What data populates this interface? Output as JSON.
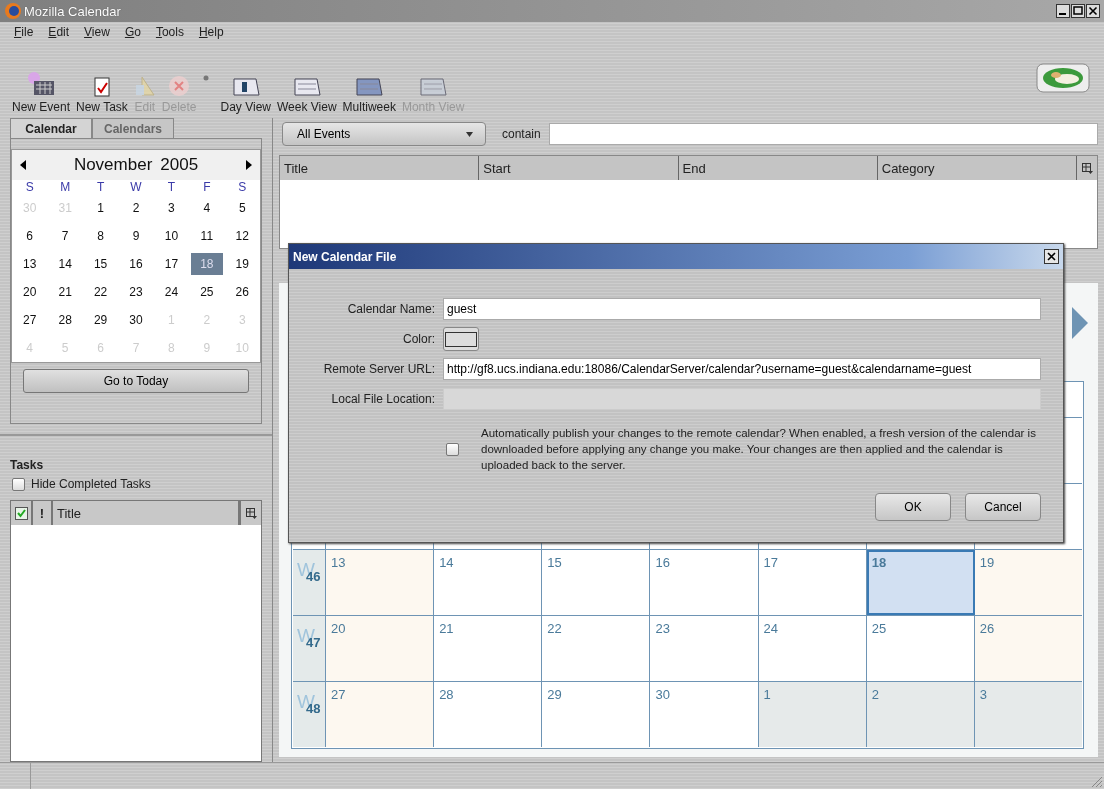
{
  "window": {
    "title": "Mozilla Calendar"
  },
  "menu": [
    "File",
    "Edit",
    "View",
    "Go",
    "Tools",
    "Help"
  ],
  "toolbar": [
    {
      "label": "New Event",
      "kind": "new-event",
      "disabled": false
    },
    {
      "label": "New Task",
      "kind": "new-task",
      "disabled": false
    },
    {
      "label": "Edit",
      "kind": "edit",
      "disabled": true
    },
    {
      "label": "Delete",
      "kind": "delete",
      "disabled": true
    },
    {
      "label": "Day View",
      "kind": "day",
      "disabled": false
    },
    {
      "label": "Week View",
      "kind": "week",
      "disabled": false
    },
    {
      "label": "Multiweek",
      "kind": "multiweek",
      "disabled": false
    },
    {
      "label": "Month View",
      "kind": "month",
      "disabled": true
    }
  ],
  "sidebar": {
    "tabs": [
      {
        "label": "Calendar",
        "selected": true
      },
      {
        "label": "Calendars",
        "selected": false
      }
    ],
    "mini_calendar": {
      "month": "November",
      "year": "2005",
      "weekdays": [
        "S",
        "M",
        "T",
        "W",
        "T",
        "F",
        "S"
      ],
      "weeks": [
        [
          {
            "day": "30",
            "outside": true,
            "selected": false
          },
          {
            "day": "31",
            "outside": true,
            "selected": false
          },
          {
            "day": "1",
            "outside": false,
            "selected": false
          },
          {
            "day": "2",
            "outside": false,
            "selected": false
          },
          {
            "day": "3",
            "outside": false,
            "selected": false
          },
          {
            "day": "4",
            "outside": false,
            "selected": false
          },
          {
            "day": "5",
            "outside": false,
            "selected": false
          }
        ],
        [
          {
            "day": "6",
            "outside": false,
            "selected": false
          },
          {
            "day": "7",
            "outside": false,
            "selected": false
          },
          {
            "day": "8",
            "outside": false,
            "selected": false
          },
          {
            "day": "9",
            "outside": false,
            "selected": false
          },
          {
            "day": "10",
            "outside": false,
            "selected": false
          },
          {
            "day": "11",
            "outside": false,
            "selected": false
          },
          {
            "day": "12",
            "outside": false,
            "selected": false
          }
        ],
        [
          {
            "day": "13",
            "outside": false,
            "selected": false
          },
          {
            "day": "14",
            "outside": false,
            "selected": false
          },
          {
            "day": "15",
            "outside": false,
            "selected": false
          },
          {
            "day": "16",
            "outside": false,
            "selected": false
          },
          {
            "day": "17",
            "outside": false,
            "selected": false
          },
          {
            "day": "18",
            "outside": false,
            "selected": true
          },
          {
            "day": "19",
            "outside": false,
            "selected": false
          }
        ],
        [
          {
            "day": "20",
            "outside": false,
            "selected": false
          },
          {
            "day": "21",
            "outside": false,
            "selected": false
          },
          {
            "day": "22",
            "outside": false,
            "selected": false
          },
          {
            "day": "23",
            "outside": false,
            "selected": false
          },
          {
            "day": "24",
            "outside": false,
            "selected": false
          },
          {
            "day": "25",
            "outside": false,
            "selected": false
          },
          {
            "day": "26",
            "outside": false,
            "selected": false
          }
        ],
        [
          {
            "day": "27",
            "outside": false,
            "selected": false
          },
          {
            "day": "28",
            "outside": false,
            "selected": false
          },
          {
            "day": "29",
            "outside": false,
            "selected": false
          },
          {
            "day": "30",
            "outside": false,
            "selected": false
          },
          {
            "day": "1",
            "outside": true,
            "selected": false
          },
          {
            "day": "2",
            "outside": true,
            "selected": false
          },
          {
            "day": "3",
            "outside": true,
            "selected": false
          }
        ],
        [
          {
            "day": "4",
            "outside": true,
            "selected": false
          },
          {
            "day": "5",
            "outside": true,
            "selected": false
          },
          {
            "day": "6",
            "outside": true,
            "selected": false
          },
          {
            "day": "7",
            "outside": true,
            "selected": false
          },
          {
            "day": "8",
            "outside": true,
            "selected": false
          },
          {
            "day": "9",
            "outside": true,
            "selected": false
          },
          {
            "day": "10",
            "outside": true,
            "selected": false
          }
        ]
      ]
    },
    "today_button": "Go to Today"
  },
  "tasks": {
    "title": "Tasks",
    "hide_completed": {
      "label": "Hide Completed Tasks",
      "checked": false
    },
    "columns": [
      {
        "kind": "done"
      },
      {
        "kind": "priority",
        "label": "!"
      },
      {
        "kind": "title",
        "label": "Title"
      },
      {
        "kind": "picker"
      }
    ]
  },
  "events": {
    "filter": "All Events",
    "contain_label": "contain",
    "columns": [
      "Title",
      "Start",
      "End",
      "Category"
    ]
  },
  "month_view": {
    "weeks": [
      {
        "label": "W",
        "number": "46",
        "days": [
          {
            "day": "13",
            "kind": "weekend",
            "selected": false
          },
          {
            "day": "14",
            "kind": "weekday",
            "selected": false
          },
          {
            "day": "15",
            "kind": "weekday",
            "selected": false
          },
          {
            "day": "16",
            "kind": "weekday",
            "selected": false
          },
          {
            "day": "17",
            "kind": "weekday",
            "selected": false
          },
          {
            "day": "18",
            "kind": "weekday",
            "selected": true
          },
          {
            "day": "19",
            "kind": "weekend",
            "selected": false
          }
        ]
      },
      {
        "label": "W",
        "number": "47",
        "days": [
          {
            "day": "20",
            "kind": "weekend",
            "selected": false
          },
          {
            "day": "21",
            "kind": "weekday",
            "selected": false
          },
          {
            "day": "22",
            "kind": "weekday",
            "selected": false
          },
          {
            "day": "23",
            "kind": "weekday",
            "selected": false
          },
          {
            "day": "24",
            "kind": "weekday",
            "selected": false
          },
          {
            "day": "25",
            "kind": "weekday",
            "selected": false
          },
          {
            "day": "26",
            "kind": "weekend",
            "selected": false
          }
        ]
      },
      {
        "label": "W",
        "number": "48",
        "days": [
          {
            "day": "27",
            "kind": "weekend",
            "selected": false
          },
          {
            "day": "28",
            "kind": "weekday",
            "selected": false
          },
          {
            "day": "29",
            "kind": "weekday",
            "selected": false
          },
          {
            "day": "30",
            "kind": "weekday",
            "selected": false
          },
          {
            "day": "1",
            "kind": "outside",
            "selected": false
          },
          {
            "day": "2",
            "kind": "outside",
            "selected": false
          },
          {
            "day": "3",
            "kind": "outside",
            "selected": false
          }
        ]
      }
    ]
  },
  "dialog": {
    "title": "New Calendar File",
    "fields": [
      {
        "label": "Calendar Name:",
        "kind": "text",
        "value": "guest",
        "disabled": false
      },
      {
        "label": "Color:",
        "kind": "color"
      },
      {
        "label": "Remote Server URL:",
        "kind": "text",
        "value": "http://gf8.ucs.indiana.edu:18086/CalendarServer/calendar?username=guest&calendarname=guest",
        "disabled": false
      },
      {
        "label": "Local File Location:",
        "kind": "text",
        "disabled": true
      }
    ],
    "publish": {
      "text": "Automatically publish your changes to the remote calendar? When enabled, a fresh version of the calendar is downloaded before applying any change you make. Your changes are then applied and the calendar is uploaded back to the server.",
      "checked": false
    },
    "buttons": [
      "OK",
      "Cancel"
    ]
  }
}
